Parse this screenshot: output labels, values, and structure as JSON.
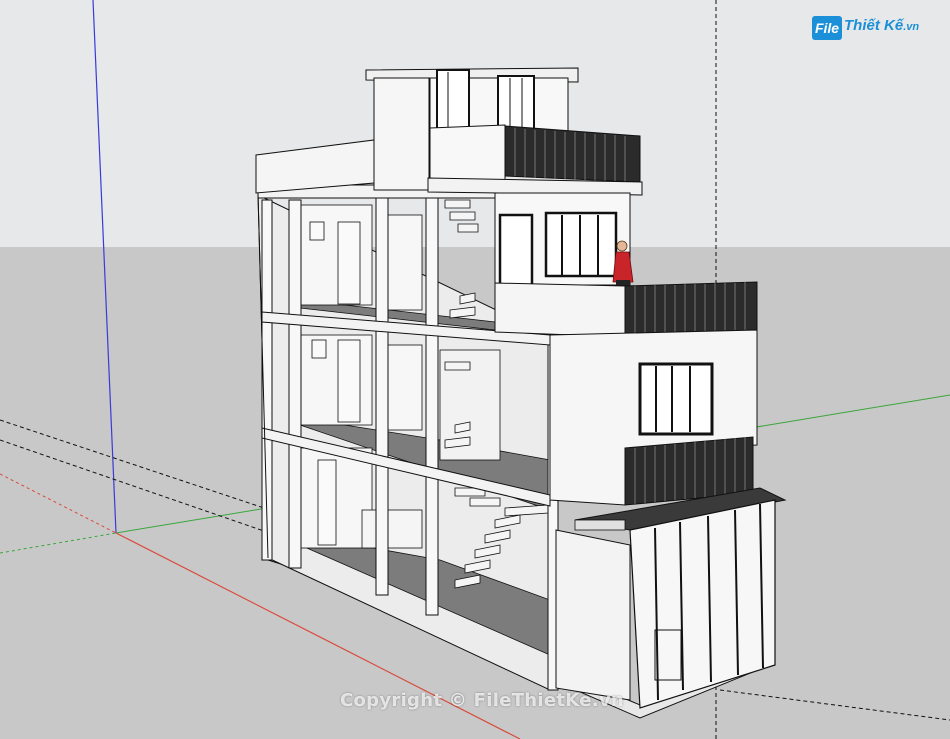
{
  "logo": {
    "badge": "File",
    "name": "Thiết Kế",
    "tld": ".vn"
  },
  "watermark": {
    "text": "Copyright © FileThietKe.vn"
  },
  "colors": {
    "sky": "#e6e8ea",
    "ground": "#c9c9c9",
    "axis_red": "#d94a3a",
    "axis_green": "#3aa63a",
    "axis_blue": "#3a3ad9",
    "railing": "#2a2a2a",
    "wall": "#f4f4f4",
    "floor": "#7d7d7d"
  },
  "icons": [
    "figure-person-icon"
  ]
}
